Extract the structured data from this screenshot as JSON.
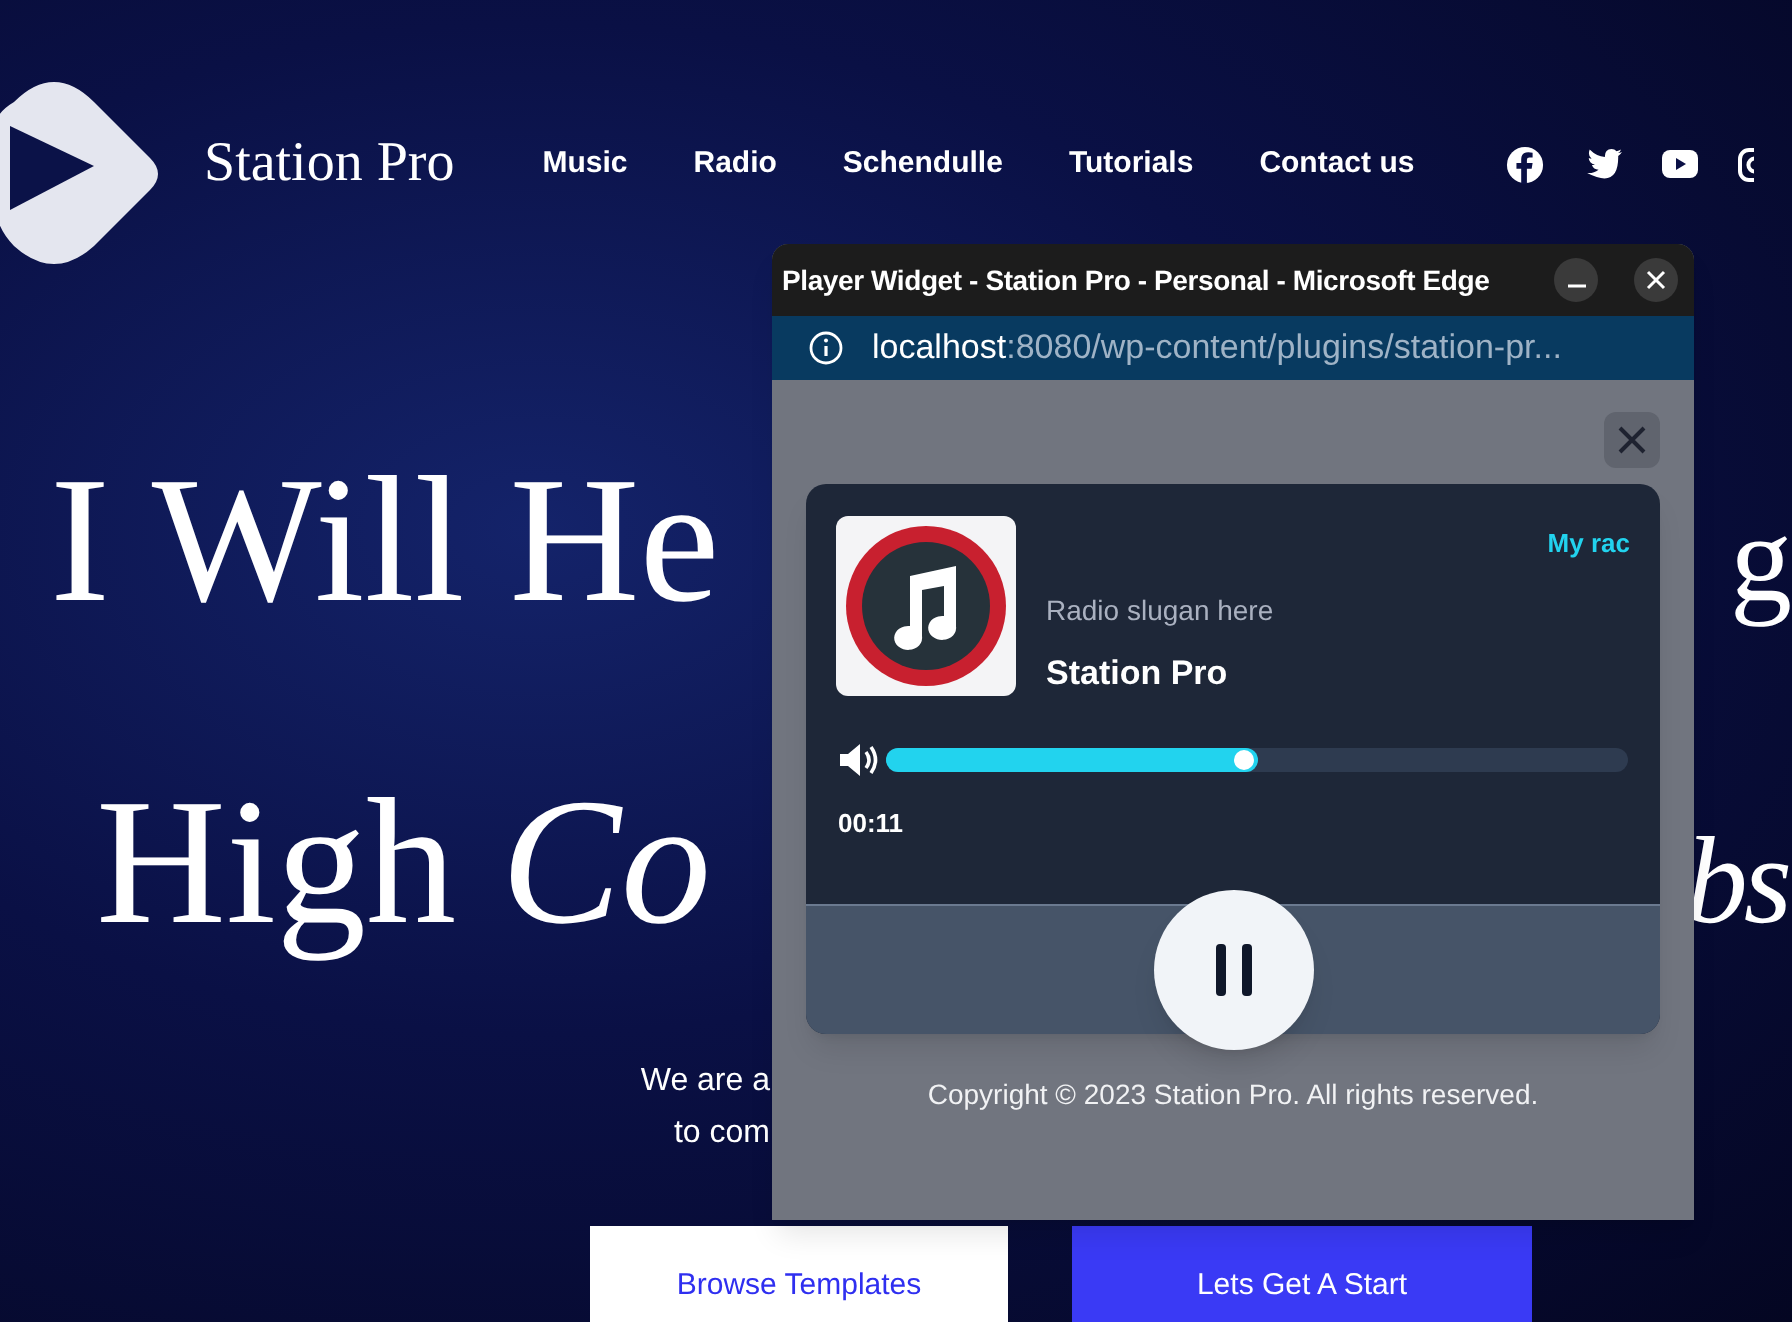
{
  "site": {
    "brand": "Station Pro",
    "nav": [
      {
        "label": "Music"
      },
      {
        "label": "Radio"
      },
      {
        "label": "Schendulle"
      },
      {
        "label": "Tutorials"
      },
      {
        "label": "Contact us"
      }
    ],
    "social": [
      {
        "kind": "facebook"
      },
      {
        "kind": "twitter"
      },
      {
        "kind": "youtube"
      },
      {
        "kind": "instagram"
      }
    ],
    "headline": [
      {
        "left": "I Will He",
        "right": "g",
        "right_italic": false
      },
      {
        "left": "High *Co*",
        "right": "bs",
        "right_italic": true
      }
    ],
    "subtitle": [
      "We are a",
      "to com"
    ],
    "buttons": [
      {
        "label": "Browse Templates",
        "kind": "secondary"
      },
      {
        "label": "Lets Get A Start",
        "kind": "primary"
      }
    ]
  },
  "window": {
    "title": "Player Widget - Station Pro - Personal - Microsoft Edge",
    "url_host": "localhost",
    "url_rest": ":8080/wp-content/plugins/station-pr...",
    "player": {
      "channel": "My rac",
      "slogan": "Radio slugan here",
      "station": "Station Pro",
      "volume": {
        "level": 0.5
      },
      "time": "00:11",
      "playing": true
    },
    "footer": "Copyright © 2023 Station Pro. All rights reserved."
  }
}
